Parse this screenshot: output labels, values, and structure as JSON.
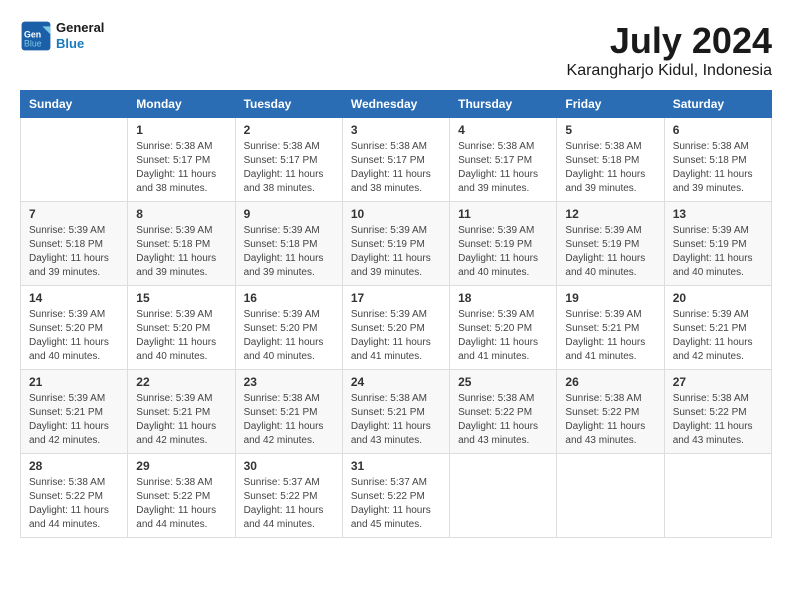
{
  "header": {
    "logo": {
      "line1": "General",
      "line2": "Blue"
    },
    "title": "July 2024",
    "subtitle": "Karangharjo Kidul, Indonesia"
  },
  "days_of_week": [
    "Sunday",
    "Monday",
    "Tuesday",
    "Wednesday",
    "Thursday",
    "Friday",
    "Saturday"
  ],
  "weeks": [
    [
      {
        "day": "",
        "sunrise": "",
        "sunset": "",
        "daylight": ""
      },
      {
        "day": "1",
        "sunrise": "Sunrise: 5:38 AM",
        "sunset": "Sunset: 5:17 PM",
        "daylight": "Daylight: 11 hours and 38 minutes."
      },
      {
        "day": "2",
        "sunrise": "Sunrise: 5:38 AM",
        "sunset": "Sunset: 5:17 PM",
        "daylight": "Daylight: 11 hours and 38 minutes."
      },
      {
        "day": "3",
        "sunrise": "Sunrise: 5:38 AM",
        "sunset": "Sunset: 5:17 PM",
        "daylight": "Daylight: 11 hours and 38 minutes."
      },
      {
        "day": "4",
        "sunrise": "Sunrise: 5:38 AM",
        "sunset": "Sunset: 5:17 PM",
        "daylight": "Daylight: 11 hours and 39 minutes."
      },
      {
        "day": "5",
        "sunrise": "Sunrise: 5:38 AM",
        "sunset": "Sunset: 5:18 PM",
        "daylight": "Daylight: 11 hours and 39 minutes."
      },
      {
        "day": "6",
        "sunrise": "Sunrise: 5:38 AM",
        "sunset": "Sunset: 5:18 PM",
        "daylight": "Daylight: 11 hours and 39 minutes."
      }
    ],
    [
      {
        "day": "7",
        "sunrise": "Sunrise: 5:39 AM",
        "sunset": "Sunset: 5:18 PM",
        "daylight": "Daylight: 11 hours and 39 minutes."
      },
      {
        "day": "8",
        "sunrise": "Sunrise: 5:39 AM",
        "sunset": "Sunset: 5:18 PM",
        "daylight": "Daylight: 11 hours and 39 minutes."
      },
      {
        "day": "9",
        "sunrise": "Sunrise: 5:39 AM",
        "sunset": "Sunset: 5:18 PM",
        "daylight": "Daylight: 11 hours and 39 minutes."
      },
      {
        "day": "10",
        "sunrise": "Sunrise: 5:39 AM",
        "sunset": "Sunset: 5:19 PM",
        "daylight": "Daylight: 11 hours and 39 minutes."
      },
      {
        "day": "11",
        "sunrise": "Sunrise: 5:39 AM",
        "sunset": "Sunset: 5:19 PM",
        "daylight": "Daylight: 11 hours and 40 minutes."
      },
      {
        "day": "12",
        "sunrise": "Sunrise: 5:39 AM",
        "sunset": "Sunset: 5:19 PM",
        "daylight": "Daylight: 11 hours and 40 minutes."
      },
      {
        "day": "13",
        "sunrise": "Sunrise: 5:39 AM",
        "sunset": "Sunset: 5:19 PM",
        "daylight": "Daylight: 11 hours and 40 minutes."
      }
    ],
    [
      {
        "day": "14",
        "sunrise": "Sunrise: 5:39 AM",
        "sunset": "Sunset: 5:20 PM",
        "daylight": "Daylight: 11 hours and 40 minutes."
      },
      {
        "day": "15",
        "sunrise": "Sunrise: 5:39 AM",
        "sunset": "Sunset: 5:20 PM",
        "daylight": "Daylight: 11 hours and 40 minutes."
      },
      {
        "day": "16",
        "sunrise": "Sunrise: 5:39 AM",
        "sunset": "Sunset: 5:20 PM",
        "daylight": "Daylight: 11 hours and 40 minutes."
      },
      {
        "day": "17",
        "sunrise": "Sunrise: 5:39 AM",
        "sunset": "Sunset: 5:20 PM",
        "daylight": "Daylight: 11 hours and 41 minutes."
      },
      {
        "day": "18",
        "sunrise": "Sunrise: 5:39 AM",
        "sunset": "Sunset: 5:20 PM",
        "daylight": "Daylight: 11 hours and 41 minutes."
      },
      {
        "day": "19",
        "sunrise": "Sunrise: 5:39 AM",
        "sunset": "Sunset: 5:21 PM",
        "daylight": "Daylight: 11 hours and 41 minutes."
      },
      {
        "day": "20",
        "sunrise": "Sunrise: 5:39 AM",
        "sunset": "Sunset: 5:21 PM",
        "daylight": "Daylight: 11 hours and 42 minutes."
      }
    ],
    [
      {
        "day": "21",
        "sunrise": "Sunrise: 5:39 AM",
        "sunset": "Sunset: 5:21 PM",
        "daylight": "Daylight: 11 hours and 42 minutes."
      },
      {
        "day": "22",
        "sunrise": "Sunrise: 5:39 AM",
        "sunset": "Sunset: 5:21 PM",
        "daylight": "Daylight: 11 hours and 42 minutes."
      },
      {
        "day": "23",
        "sunrise": "Sunrise: 5:38 AM",
        "sunset": "Sunset: 5:21 PM",
        "daylight": "Daylight: 11 hours and 42 minutes."
      },
      {
        "day": "24",
        "sunrise": "Sunrise: 5:38 AM",
        "sunset": "Sunset: 5:21 PM",
        "daylight": "Daylight: 11 hours and 43 minutes."
      },
      {
        "day": "25",
        "sunrise": "Sunrise: 5:38 AM",
        "sunset": "Sunset: 5:22 PM",
        "daylight": "Daylight: 11 hours and 43 minutes."
      },
      {
        "day": "26",
        "sunrise": "Sunrise: 5:38 AM",
        "sunset": "Sunset: 5:22 PM",
        "daylight": "Daylight: 11 hours and 43 minutes."
      },
      {
        "day": "27",
        "sunrise": "Sunrise: 5:38 AM",
        "sunset": "Sunset: 5:22 PM",
        "daylight": "Daylight: 11 hours and 43 minutes."
      }
    ],
    [
      {
        "day": "28",
        "sunrise": "Sunrise: 5:38 AM",
        "sunset": "Sunset: 5:22 PM",
        "daylight": "Daylight: 11 hours and 44 minutes."
      },
      {
        "day": "29",
        "sunrise": "Sunrise: 5:38 AM",
        "sunset": "Sunset: 5:22 PM",
        "daylight": "Daylight: 11 hours and 44 minutes."
      },
      {
        "day": "30",
        "sunrise": "Sunrise: 5:37 AM",
        "sunset": "Sunset: 5:22 PM",
        "daylight": "Daylight: 11 hours and 44 minutes."
      },
      {
        "day": "31",
        "sunrise": "Sunrise: 5:37 AM",
        "sunset": "Sunset: 5:22 PM",
        "daylight": "Daylight: 11 hours and 45 minutes."
      },
      {
        "day": "",
        "sunrise": "",
        "sunset": "",
        "daylight": ""
      },
      {
        "day": "",
        "sunrise": "",
        "sunset": "",
        "daylight": ""
      },
      {
        "day": "",
        "sunrise": "",
        "sunset": "",
        "daylight": ""
      }
    ]
  ]
}
